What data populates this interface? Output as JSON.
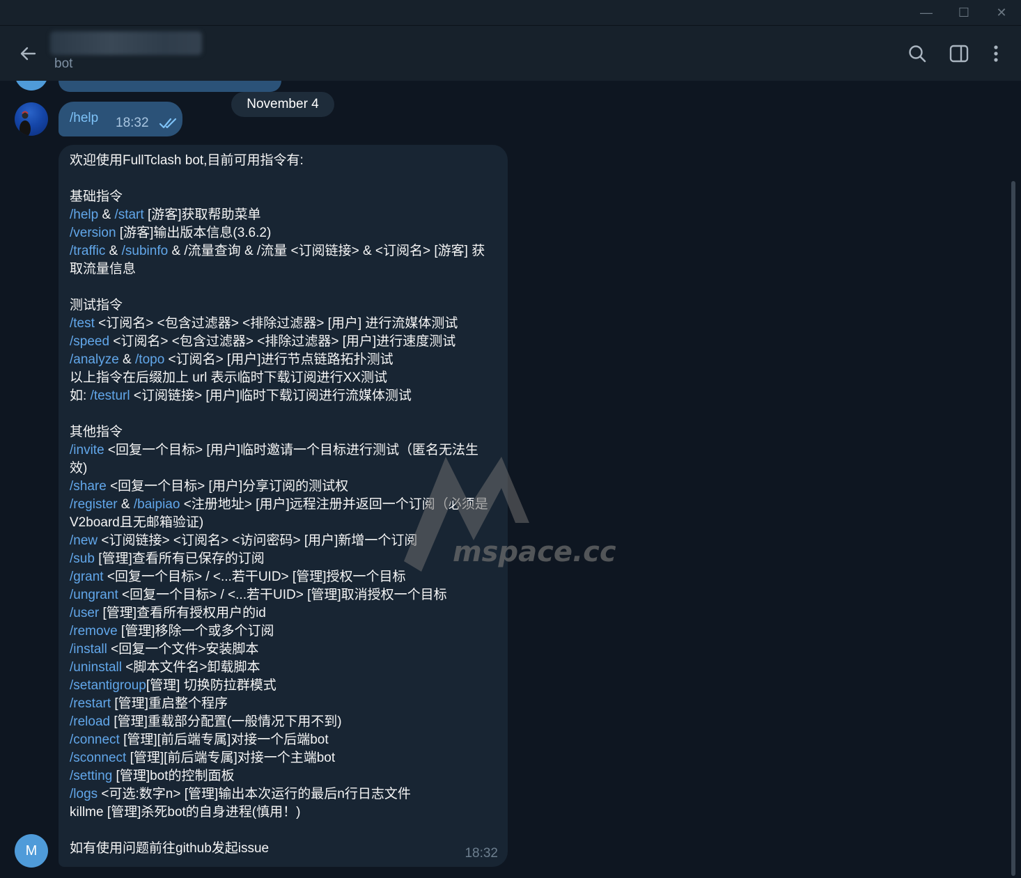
{
  "window": {
    "minimize": "—",
    "maximize": "☐",
    "close": "✕"
  },
  "header": {
    "subtitle": "bot"
  },
  "chat": {
    "date_separator": "November 4",
    "outgoing": {
      "text": "/help",
      "time": "18:32",
      "status": "read"
    },
    "incoming": {
      "time": "18:32",
      "lines": [
        [
          {
            "t": "欢迎使用FullTclash bot,目前可用指令有:"
          }
        ],
        [],
        [
          {
            "t": "基础指令"
          }
        ],
        [
          {
            "t": "/help",
            "c": 1
          },
          {
            "t": " & "
          },
          {
            "t": "/start",
            "c": 1
          },
          {
            "t": " [游客]获取帮助菜单"
          }
        ],
        [
          {
            "t": "/version",
            "c": 1
          },
          {
            "t": " [游客]输出版本信息(3.6.2)"
          }
        ],
        [
          {
            "t": "/traffic",
            "c": 1
          },
          {
            "t": " & "
          },
          {
            "t": "/subinfo",
            "c": 1
          },
          {
            "t": " & /流量查询 & /流量 <订阅链接> & <订阅名> [游客] 获取流量信息"
          }
        ],
        [],
        [
          {
            "t": "测试指令"
          }
        ],
        [
          {
            "t": "/test",
            "c": 1
          },
          {
            "t": " <订阅名> <包含过滤器> <排除过滤器> [用户] 进行流媒体测试"
          }
        ],
        [
          {
            "t": "/speed",
            "c": 1
          },
          {
            "t": " <订阅名> <包含过滤器> <排除过滤器> [用户]进行速度测试"
          }
        ],
        [
          {
            "t": "/analyze",
            "c": 1
          },
          {
            "t": " & "
          },
          {
            "t": "/topo",
            "c": 1
          },
          {
            "t": " <订阅名> [用户]进行节点链路拓扑测试"
          }
        ],
        [
          {
            "t": "以上指令在后缀加上 url 表示临时下载订阅进行XX测试"
          }
        ],
        [
          {
            "t": "如: "
          },
          {
            "t": "/testurl",
            "c": 1
          },
          {
            "t": " <订阅链接> [用户]临时下载订阅进行流媒体测试"
          }
        ],
        [],
        [
          {
            "t": "其他指令"
          }
        ],
        [
          {
            "t": "/invite",
            "c": 1
          },
          {
            "t": " <回复一个目标> [用户]临时邀请一个目标进行测试（匿名无法生效)"
          }
        ],
        [
          {
            "t": "/share",
            "c": 1
          },
          {
            "t": " <回复一个目标> [用户]分享订阅的测试权"
          }
        ],
        [
          {
            "t": "/register",
            "c": 1
          },
          {
            "t": " & "
          },
          {
            "t": "/baipiao",
            "c": 1
          },
          {
            "t": " <注册地址> [用户]远程注册并返回一个订阅（必须是V2board且无邮箱验证)"
          }
        ],
        [
          {
            "t": "/new",
            "c": 1
          },
          {
            "t": " <订阅链接> <订阅名> <访问密码> [用户]新增一个订阅"
          }
        ],
        [
          {
            "t": "/sub",
            "c": 1
          },
          {
            "t": " [管理]查看所有已保存的订阅"
          }
        ],
        [
          {
            "t": "/grant",
            "c": 1
          },
          {
            "t": " <回复一个目标> / <...若干UID> [管理]授权一个目标"
          }
        ],
        [
          {
            "t": "/ungrant",
            "c": 1
          },
          {
            "t": " <回复一个目标> / <...若干UID> [管理]取消授权一个目标"
          }
        ],
        [
          {
            "t": "/user",
            "c": 1
          },
          {
            "t": " [管理]查看所有授权用户的id"
          }
        ],
        [
          {
            "t": "/remove",
            "c": 1
          },
          {
            "t": " [管理]移除一个或多个订阅"
          }
        ],
        [
          {
            "t": "/install",
            "c": 1
          },
          {
            "t": " <回复一个文件>安装脚本"
          }
        ],
        [
          {
            "t": "/uninstall",
            "c": 1
          },
          {
            "t": " <脚本文件名>卸载脚本"
          }
        ],
        [
          {
            "t": "/setantigroup",
            "c": 1
          },
          {
            "t": "[管理] 切换防拉群模式"
          }
        ],
        [
          {
            "t": "/restart",
            "c": 1
          },
          {
            "t": " [管理]重启整个程序"
          }
        ],
        [
          {
            "t": "/reload",
            "c": 1
          },
          {
            "t": " [管理]重载部分配置(一般情况下用不到)"
          }
        ],
        [
          {
            "t": "/connect",
            "c": 1
          },
          {
            "t": " [管理][前后端专属]对接一个后端bot"
          }
        ],
        [
          {
            "t": "/sconnect",
            "c": 1
          },
          {
            "t": " [管理][前后端专属]对接一个主端bot"
          }
        ],
        [
          {
            "t": "/setting",
            "c": 1
          },
          {
            "t": " [管理]bot的控制面板"
          }
        ],
        [
          {
            "t": "/logs",
            "c": 1
          },
          {
            "t": " <可选:数字n> [管理]输出本次运行的最后n行日志文件"
          }
        ],
        [
          {
            "t": "killme [管理]杀死bot的自身进程(慎用！)"
          }
        ],
        [],
        [
          {
            "t": "如有使用问题前往github发起issue"
          }
        ]
      ]
    },
    "bottom_avatar_letter": "M",
    "watermark": "mspace.cc"
  },
  "colors": {
    "accent": "#62a7ea",
    "outgoing_bubble": "#2b5278",
    "incoming_bubble": "#182533",
    "background": "#0e1621"
  },
  "icons": [
    "back-arrow-icon",
    "search-icon",
    "sidebar-panel-icon",
    "more-vertical-icon",
    "double-check-icon"
  ]
}
